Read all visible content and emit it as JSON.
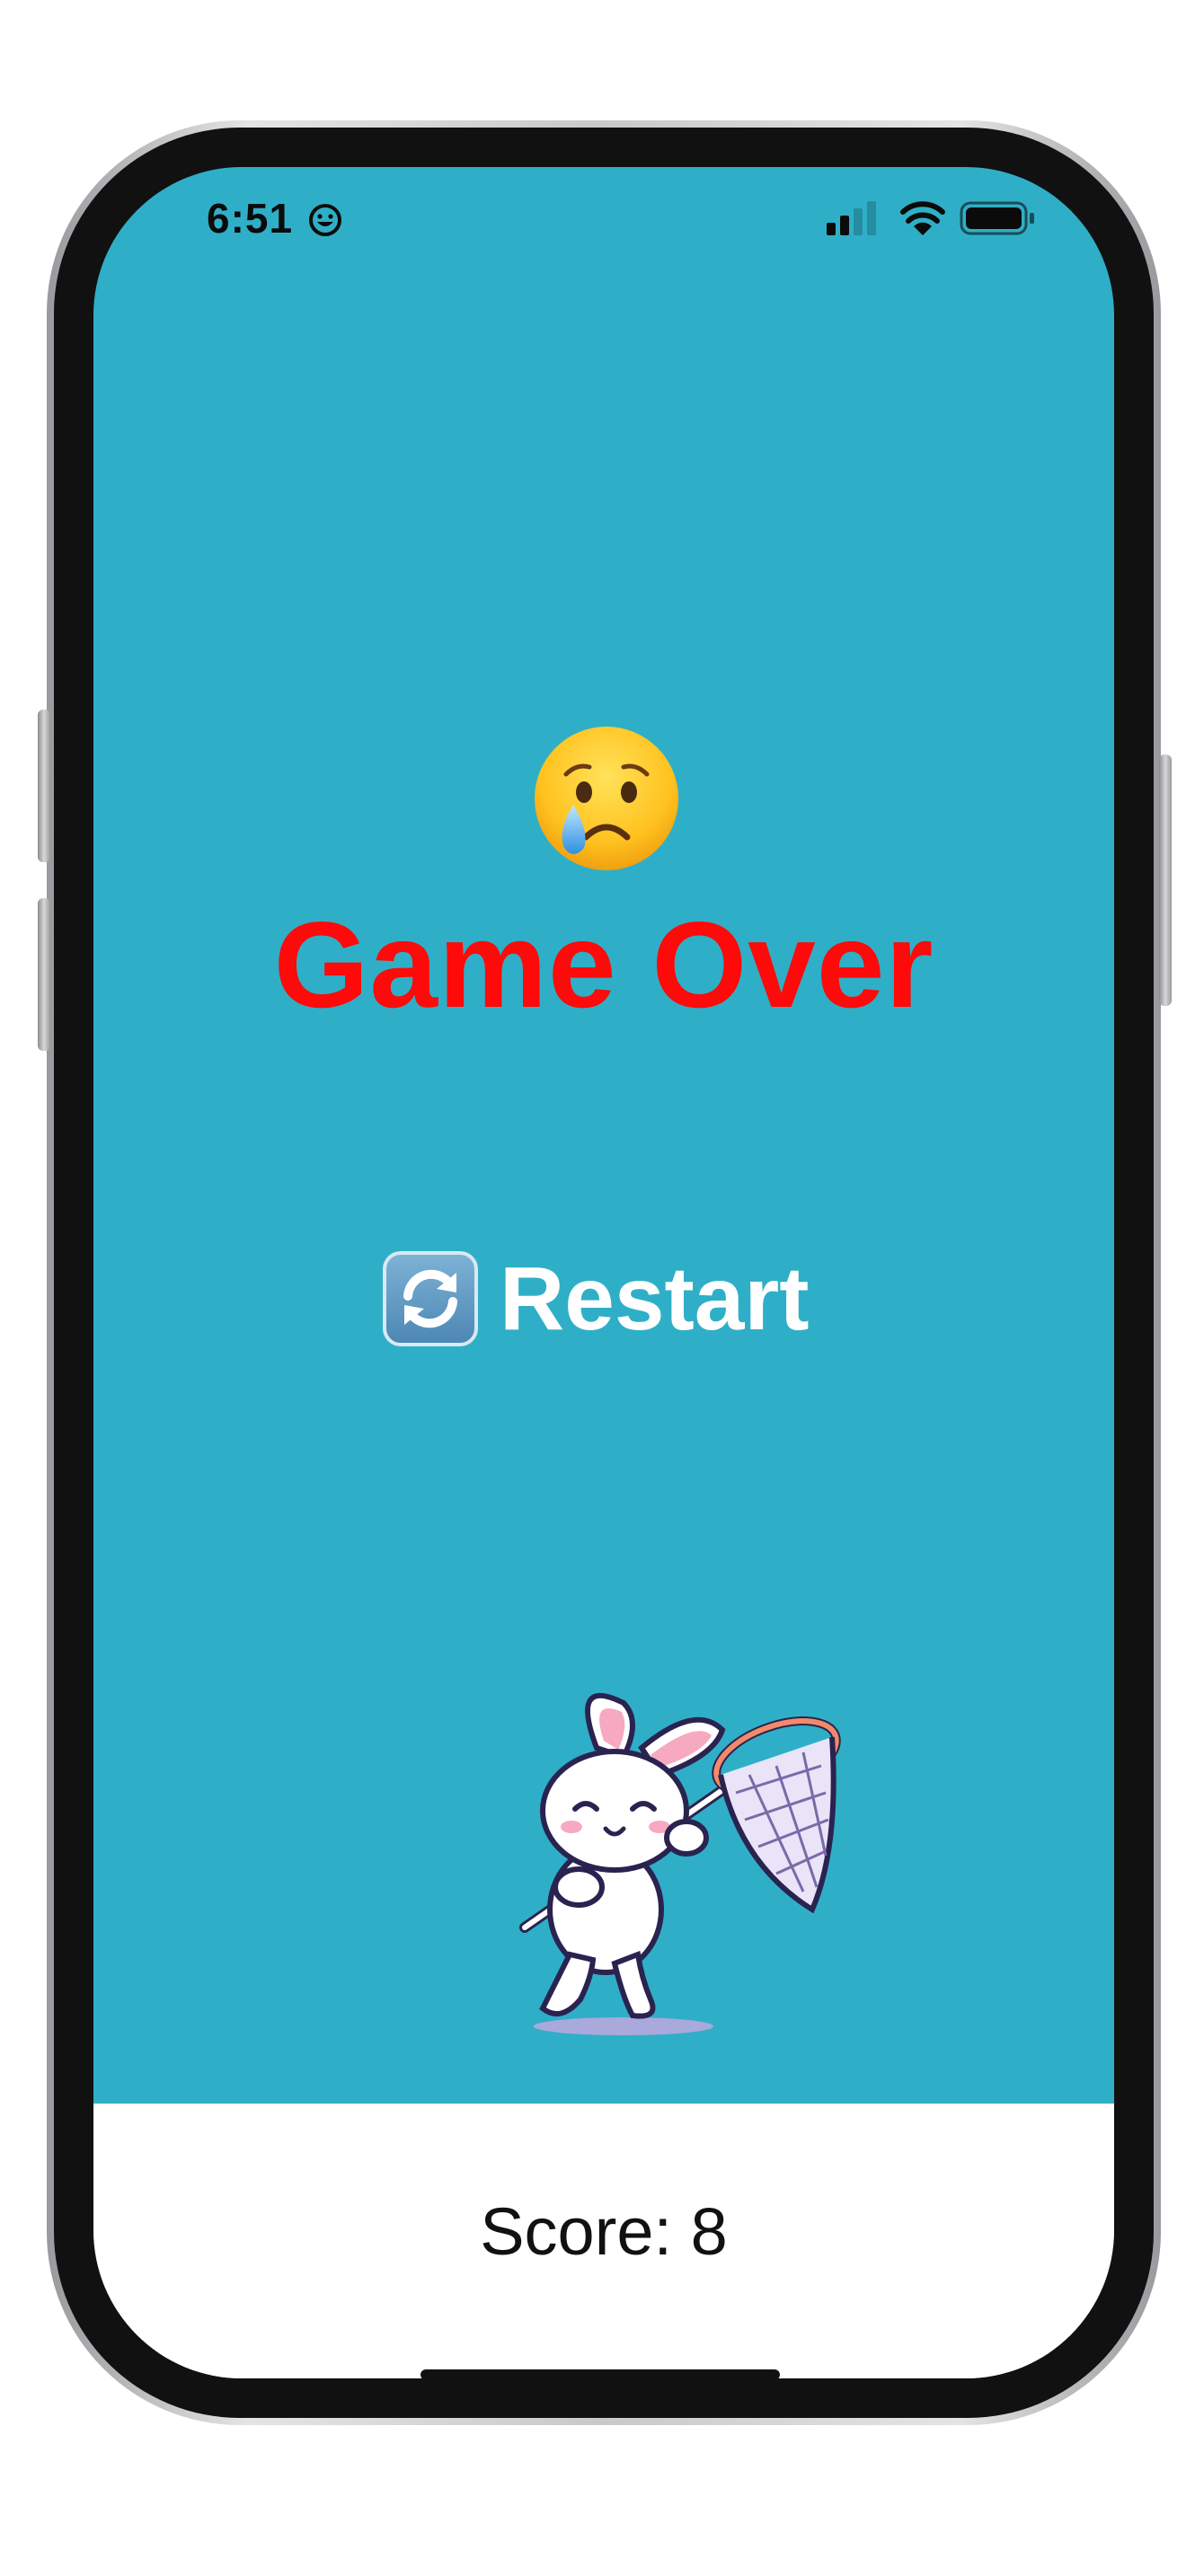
{
  "status_bar": {
    "time": "6:51",
    "time_icon": "smiley-face-icon",
    "icons": [
      "cellular-signal-icon",
      "wifi-icon",
      "battery-icon"
    ]
  },
  "game_over": {
    "emoji_icon": "crying-face-emoji-icon",
    "title": "Game Over",
    "title_color": "#ff0a0a"
  },
  "restart_button": {
    "icon": "counterclockwise-arrows-icon",
    "label": "Restart"
  },
  "character": "bunny-with-butterfly-net",
  "score": {
    "label": "Score: 8",
    "value": 8
  },
  "colors": {
    "background": "#2fafc7",
    "score_bar": "#ffffff"
  }
}
